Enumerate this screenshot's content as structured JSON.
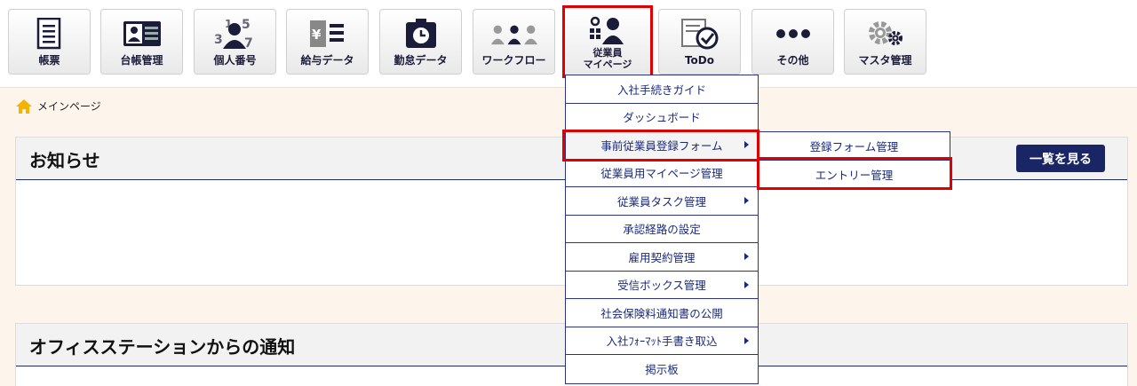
{
  "toolbar": {
    "buttons": [
      {
        "label": "帳票",
        "icon": "document-list-icon"
      },
      {
        "label": "台帳管理",
        "icon": "ledger-card-icon"
      },
      {
        "label": "個人番号",
        "icon": "personal-number-icon"
      },
      {
        "label": "給与データ",
        "icon": "payroll-icon"
      },
      {
        "label": "勤怠データ",
        "icon": "attendance-clock-icon"
      },
      {
        "label": "ワークフロー",
        "icon": "workflow-people-icon"
      },
      {
        "label_line1": "従業員",
        "label_line2": "マイページ",
        "icon": "employee-mypage-icon"
      },
      {
        "label": "ToDo",
        "icon": "todo-check-icon"
      },
      {
        "label": "その他",
        "icon": "more-dots-icon"
      },
      {
        "label": "マスタ管理",
        "icon": "gears-icon"
      }
    ]
  },
  "breadcrumb": {
    "label": "メインページ"
  },
  "notices": {
    "title": "お知らせ",
    "see_all": "一覧を見る"
  },
  "office_notices": {
    "title": "オフィスステーションからの通知"
  },
  "menu": {
    "items": [
      {
        "label": "入社手続きガイド",
        "has_sub": false
      },
      {
        "label": "ダッシュボード",
        "has_sub": false
      },
      {
        "label": "事前従業員登録フォーム",
        "has_sub": true
      },
      {
        "label": "従業員用マイページ管理",
        "has_sub": false
      },
      {
        "label": "従業員タスク管理",
        "has_sub": true
      },
      {
        "label": "承認経路の設定",
        "has_sub": false
      },
      {
        "label": "雇用契約管理",
        "has_sub": true
      },
      {
        "label": "受信ボックス管理",
        "has_sub": true
      },
      {
        "label": "社会保険料通知書の公開",
        "has_sub": false
      },
      {
        "label": "入社ﾌｫｰﾏｯﾄ手書き取込",
        "has_sub": true
      },
      {
        "label": "掲示板",
        "has_sub": false
      }
    ]
  },
  "submenu": {
    "items": [
      {
        "label": "登録フォーム管理"
      },
      {
        "label": "エントリー管理"
      }
    ]
  },
  "colors": {
    "accent": "#1a2566",
    "highlight": "#e00000",
    "background": "#fdf5ec",
    "home_icon": "#f5b300"
  }
}
